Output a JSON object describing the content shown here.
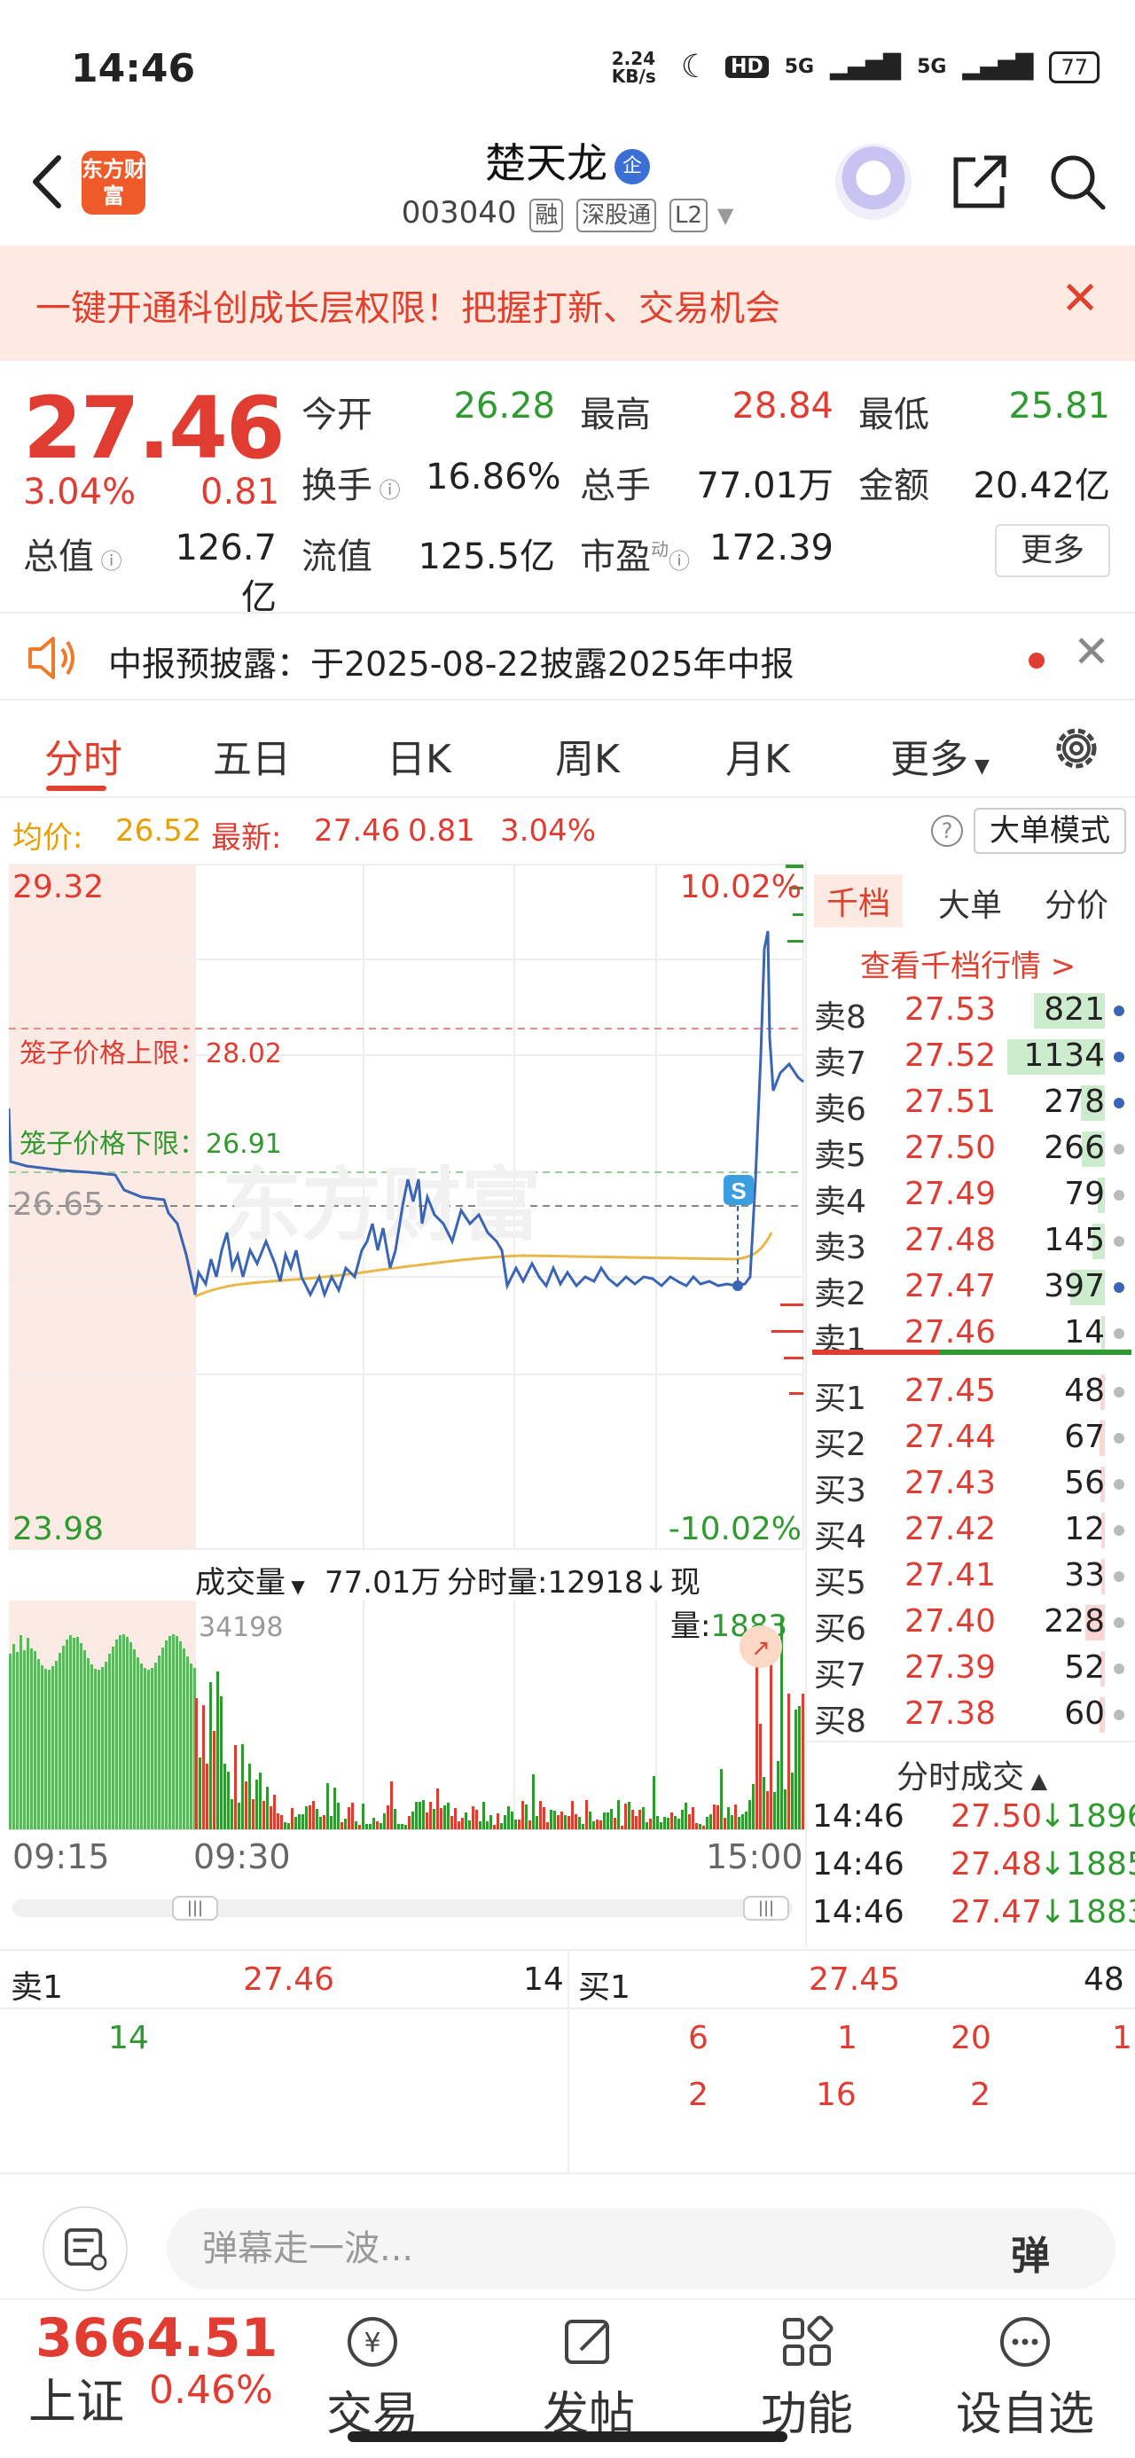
{
  "status_bar": {
    "time": "14:46",
    "net_speed": "2.24 KB/s",
    "hd": "HD",
    "signal1": "5G",
    "signal2": "5G",
    "battery": "77"
  },
  "header": {
    "logo_text": "东方财富",
    "stock_name": "楚天龙",
    "badge": "企",
    "code": "003040",
    "tags": [
      "融",
      "深股通",
      "L2"
    ]
  },
  "banner": {
    "text": "一键开通科创成长层权限！把握打新、交易机会"
  },
  "quote": {
    "price": "27.46",
    "change_pct": "3.04%",
    "change": "0.81",
    "open_label": "今开",
    "open": "26.28",
    "high_label": "最高",
    "high": "28.84",
    "low_label": "最低",
    "low": "25.81",
    "turnover_label": "换手",
    "turnover": "16.86%",
    "volume_label": "总手",
    "volume": "77.01万",
    "amount_label": "金额",
    "amount": "20.42亿",
    "mktcap_label": "总值",
    "mktcap": "126.7亿",
    "float_label": "流值",
    "float": "125.5亿",
    "pe_label": "市盈",
    "pe_sup": "动",
    "pe": "172.39",
    "more_label": "更多"
  },
  "notice": {
    "text": "中报预披露：于2025-08-22披露2025年中报"
  },
  "tabs": [
    "分时",
    "五日",
    "日K",
    "周K",
    "月K",
    "更多"
  ],
  "info_line": {
    "avg_label": "均价:",
    "avg": "26.52",
    "latest_label": "最新:",
    "latest": "27.46",
    "chg": "0.81",
    "pct": "3.04%",
    "help": "?",
    "mode_button": "大单模式"
  },
  "chart": {
    "y_top": "29.32",
    "y_bottom": "23.98",
    "y_ref": "26.65",
    "pct_top": "10.02%",
    "pct_bottom": "-10.02%",
    "cage_upper": "笼子价格上限：28.02",
    "cage_lower": "笼子价格下限：26.91",
    "marker": "S",
    "watermark": "东方财富",
    "colors": {
      "price": "#3a65b5",
      "avg": "#e8b84a",
      "up": "#e03c32",
      "down": "#2f9a2f"
    }
  },
  "volume_bar": {
    "label": "成交量",
    "total": "77.01万",
    "period_label": "分时量:",
    "period": "12918",
    "now_label": "现量:",
    "now": "1883",
    "max": "34198",
    "times": [
      "09:15",
      "09:30",
      "15:00"
    ]
  },
  "order_book": {
    "tabs": [
      "千档",
      "大单",
      "分价"
    ],
    "link": "查看千档行情 >",
    "asks": [
      {
        "label": "卖8",
        "price": "27.53",
        "vol": "821"
      },
      {
        "label": "卖7",
        "price": "27.52",
        "vol": "1134"
      },
      {
        "label": "卖6",
        "price": "27.51",
        "vol": "278"
      },
      {
        "label": "卖5",
        "price": "27.50",
        "vol": "266"
      },
      {
        "label": "卖4",
        "price": "27.49",
        "vol": "79"
      },
      {
        "label": "卖3",
        "price": "27.48",
        "vol": "145"
      },
      {
        "label": "卖2",
        "price": "27.47",
        "vol": "397"
      },
      {
        "label": "卖1",
        "price": "27.46",
        "vol": "14"
      }
    ],
    "bids": [
      {
        "label": "买1",
        "price": "27.45",
        "vol": "48"
      },
      {
        "label": "买2",
        "price": "27.44",
        "vol": "67"
      },
      {
        "label": "买3",
        "price": "27.43",
        "vol": "56"
      },
      {
        "label": "买4",
        "price": "27.42",
        "vol": "12"
      },
      {
        "label": "买5",
        "price": "27.41",
        "vol": "33"
      },
      {
        "label": "买6",
        "price": "27.40",
        "vol": "228"
      },
      {
        "label": "买7",
        "price": "27.39",
        "vol": "52"
      },
      {
        "label": "买8",
        "price": "27.38",
        "vol": "60"
      }
    ],
    "trades_title": "分时成交",
    "trades": [
      {
        "time": "14:46",
        "price": "27.50",
        "vol": "↓1896"
      },
      {
        "time": "14:46",
        "price": "27.48",
        "vol": "↓1885"
      },
      {
        "time": "14:46",
        "price": "27.47",
        "vol": "↓1883"
      }
    ]
  },
  "queue": {
    "sell_label": "卖1",
    "sell_price": "27.46",
    "sell_vol": "14",
    "buy_label": "买1",
    "buy_price": "27.45",
    "buy_vol": "48",
    "sell_items": [
      "14"
    ],
    "buy_row1": [
      "6",
      "1",
      "20",
      "1"
    ],
    "buy_row2": [
      "2",
      "16",
      "2"
    ]
  },
  "danmu": {
    "placeholder": "弹幕走一波...",
    "send": "弹"
  },
  "bottom_nav": {
    "index_value": "3664.51",
    "index_name": "上证",
    "index_pct": "0.46%",
    "items": [
      "交易",
      "发帖",
      "功能",
      "设自选"
    ]
  }
}
